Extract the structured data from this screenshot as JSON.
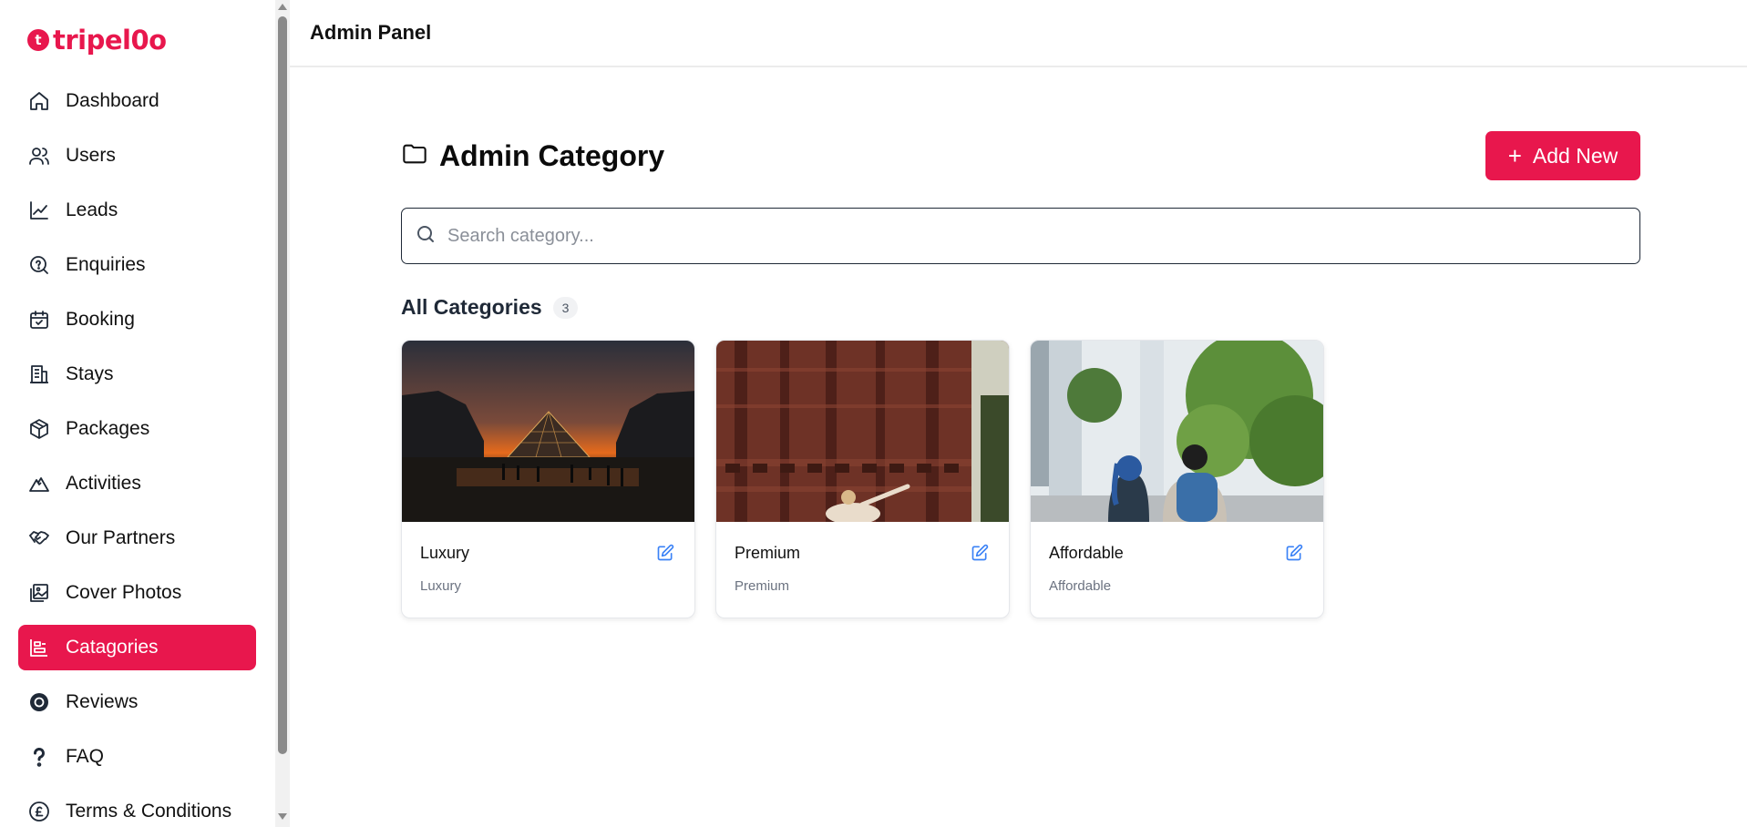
{
  "app": {
    "brand": "tripel0o",
    "brand_mark": "t",
    "brand_color": "#e8174d"
  },
  "sidebar": {
    "items": [
      {
        "label": "Dashboard",
        "icon": "home-icon"
      },
      {
        "label": "Users",
        "icon": "users-icon"
      },
      {
        "label": "Leads",
        "icon": "chart-line-icon"
      },
      {
        "label": "Enquiries",
        "icon": "search-question-icon"
      },
      {
        "label": "Booking",
        "icon": "calendar-check-icon"
      },
      {
        "label": "Stays",
        "icon": "building-icon"
      },
      {
        "label": "Packages",
        "icon": "package-icon"
      },
      {
        "label": "Activities",
        "icon": "mountain-icon"
      },
      {
        "label": "Our Partners",
        "icon": "handshake-icon"
      },
      {
        "label": "Cover Photos",
        "icon": "images-icon"
      },
      {
        "label": "Catagories",
        "icon": "categories-icon",
        "active": true
      },
      {
        "label": "Reviews",
        "icon": "record-icon"
      },
      {
        "label": "FAQ",
        "icon": "question-icon"
      },
      {
        "label": "Terms & Conditions",
        "icon": "pound-circle-icon"
      }
    ]
  },
  "topbar": {
    "title": "Admin Panel"
  },
  "main": {
    "title": "Admin Category",
    "add_button_label": "Add New",
    "search_placeholder": "Search category...",
    "section_title": "All Categories",
    "count": "3",
    "cards": [
      {
        "title": "Luxury",
        "subtitle": "Luxury",
        "image": "louvre-pyramid-sunset"
      },
      {
        "title": "Premium",
        "subtitle": "Premium",
        "image": "brick-arch-woman"
      },
      {
        "title": "Affordable",
        "subtitle": "Affordable",
        "image": "backpackers-park"
      }
    ]
  },
  "colors": {
    "accent": "#e8174d",
    "edit_icon": "#3b82f6"
  }
}
